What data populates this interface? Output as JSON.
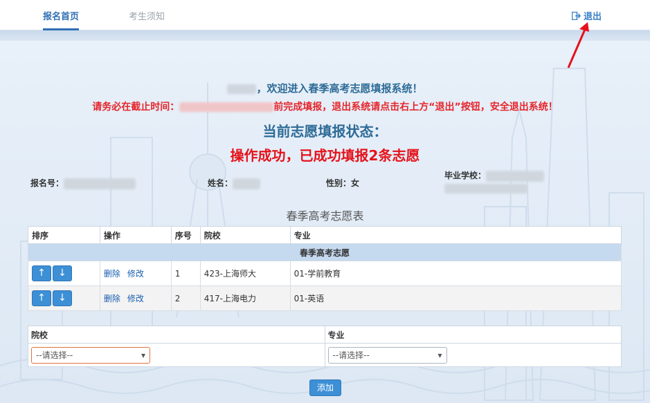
{
  "nav": {
    "tabs": [
      {
        "label": "报名首页",
        "active": true
      },
      {
        "label": "考生须知",
        "active": false
      }
    ],
    "logout_label": "退出",
    "logout_icon": "sign-out-icon"
  },
  "welcome_suffix": "，欢迎进入春季高考志愿填报系统！",
  "deadline_prefix": "请务必在截止时间：",
  "deadline_suffix": "前完成填报，退出系统请点击右上方“退出”按钮，安全退出系统！",
  "status": {
    "title": "当前志愿填报状态：",
    "value": "操作成功，已成功填报2条志愿"
  },
  "info": {
    "reg_no_label": "报名号：",
    "name_label": "姓名：",
    "gender_label": "性别：",
    "gender_value": "女",
    "school_label": "毕业学校："
  },
  "table": {
    "title": "春季高考志愿表",
    "headers": [
      "排序",
      "操作",
      "序号",
      "院校",
      "专业"
    ],
    "group_label": "春季高考志愿",
    "up_label": "↑",
    "down_label": "↓",
    "delete_label": "删除",
    "edit_label": "修改",
    "rows": [
      {
        "seq": "1",
        "school": "423-上海师大",
        "major": "01-学前教育"
      },
      {
        "seq": "2",
        "school": "417-上海电力",
        "major": "01-英语"
      }
    ]
  },
  "form": {
    "school_label": "院校",
    "major_label": "专业",
    "school_placeholder": "--请选择--",
    "major_placeholder": "--请选择--",
    "add_label": "添加"
  },
  "colors": {
    "accent": "#2f6fb5",
    "danger": "#e5121b",
    "button": "#3d8fd6"
  }
}
